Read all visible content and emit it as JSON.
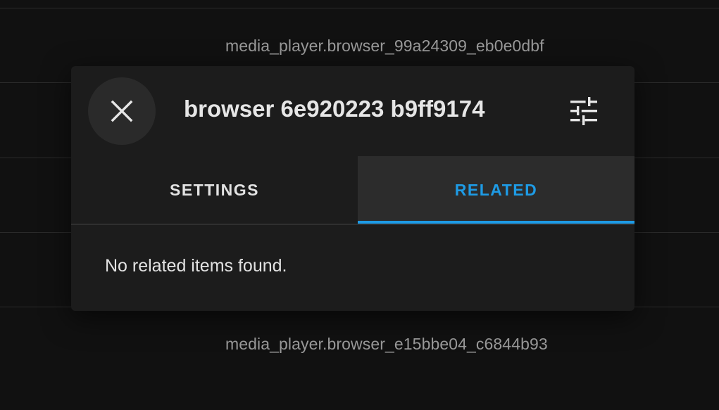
{
  "background": {
    "entity_ids": [
      "media_player.browser_99a24309_eb0e0dbf",
      "media_player.browser_e15bbe04_c6844b93"
    ]
  },
  "dialog": {
    "title": "browser 6e920223 b9ff9174",
    "close_icon": "close-icon",
    "settings_icon": "tune-icon",
    "tabs": [
      {
        "label": "SETTINGS",
        "active": false
      },
      {
        "label": "RELATED",
        "active": true
      }
    ],
    "content_message": "No related items found."
  },
  "colors": {
    "accent": "#1e9be5",
    "dialog_bg": "#1c1c1c",
    "page_bg": "#111111"
  }
}
